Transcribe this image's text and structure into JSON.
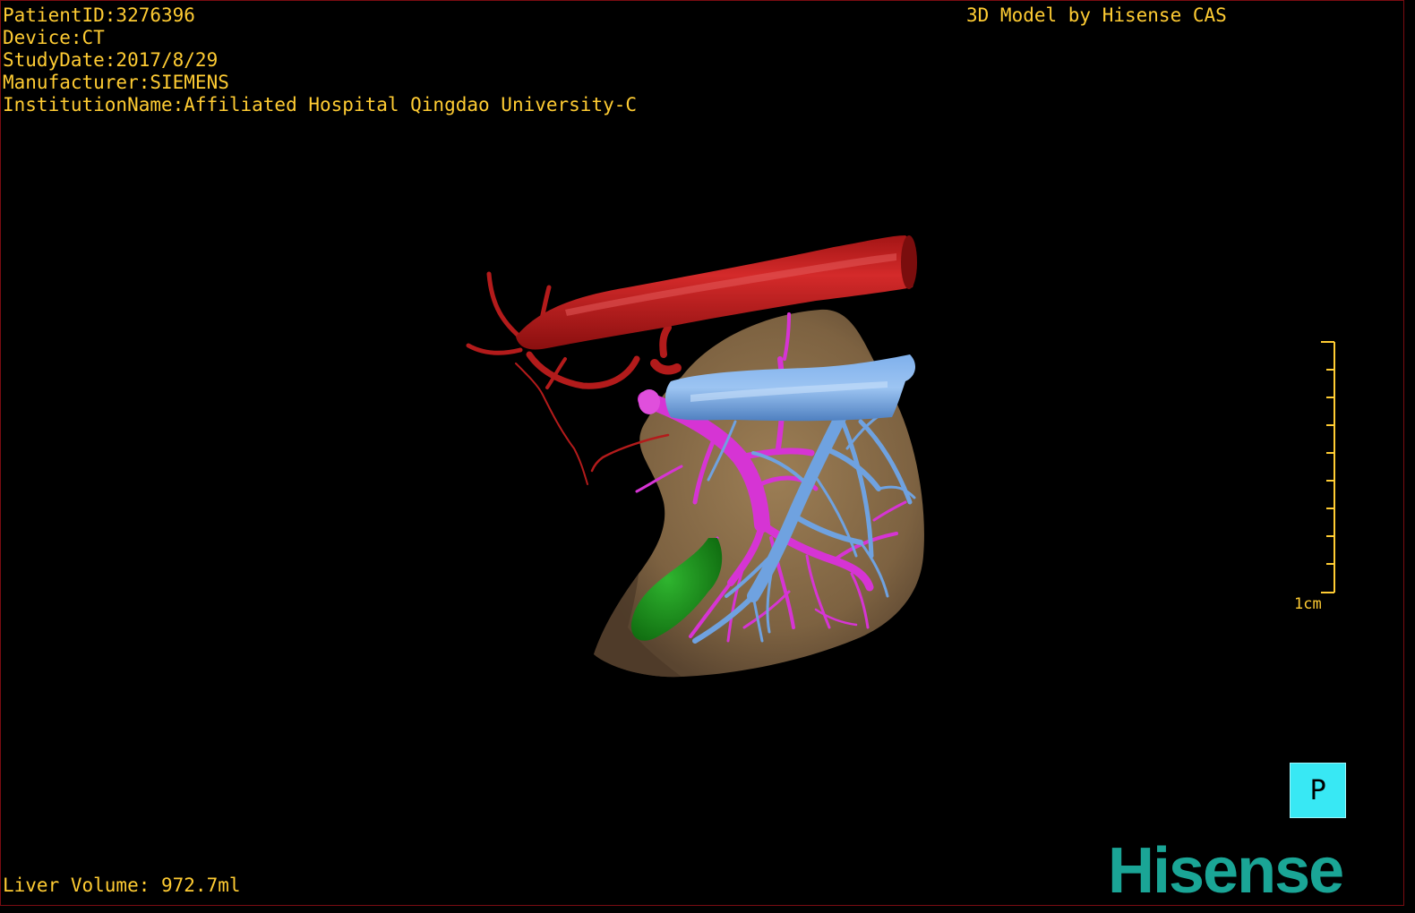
{
  "dicom_info": {
    "patient_id": "PatientID:3276396",
    "device": "Device:CT",
    "study_date": "StudyDate:2017/8/29",
    "manufacturer": "Manufacturer:SIEMENS",
    "institution": "InstitutionName:Affiliated Hospital Qingdao University-C"
  },
  "caption": "3D Model by Hisense CAS",
  "liver_volume": "Liver Volume: 972.7ml",
  "scale": {
    "label": "1cm"
  },
  "orientation": {
    "label": "P"
  },
  "brand": {
    "logo_text": "Hisense"
  },
  "colors": {
    "overlay_text": "#ffcc33",
    "liver": "#8a6e4a",
    "artery": "#c41a1a",
    "portal_vein": "#d634d4",
    "hepatic_vein": "#6fa2e0",
    "gallbladder": "#1f8f1f",
    "orientation_cube": "#38e8f4",
    "brand": "#1aa596"
  }
}
